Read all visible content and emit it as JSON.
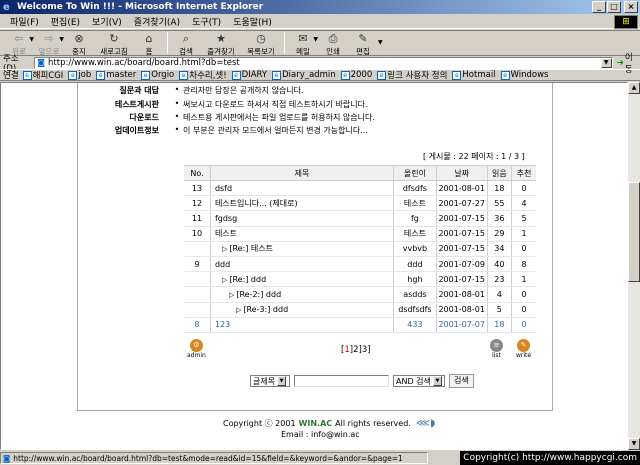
{
  "window": {
    "title": "Welcome To Win !!! - Microsoft Internet Explorer"
  },
  "menu": [
    "파일(F)",
    "편집(E)",
    "보기(V)",
    "즐겨찾기(A)",
    "도구(T)",
    "도움말(H)"
  ],
  "toolbar": {
    "back": "뒤로",
    "forward": "앞으로",
    "stop": "중지",
    "refresh": "새로고침",
    "home": "홈",
    "search": "검색",
    "favorites": "즐겨찾기",
    "history": "목록보기",
    "mail": "메일",
    "print": "인쇄",
    "edit": "편집"
  },
  "address": {
    "label": "주소(D)",
    "url": "http://www.win.ac/board/board.html?db=test",
    "go": "이동"
  },
  "links": {
    "label": "연결",
    "items": [
      "해피CGI",
      "job",
      "master",
      "Orgio",
      "차수리,셋!",
      "DIARY",
      "Diary_admin",
      "2000",
      "링크 사용자 정의",
      "Hotmail",
      "Windows"
    ]
  },
  "info": [
    {
      "key": "질문과 대답",
      "value": "관리자만 답장은 공개하지 않습니다."
    },
    {
      "key": "테스트게시판",
      "value": "써보시고 다운로드 하셔서 직접 테스트하시기 바랍니다."
    },
    {
      "key": "다운로드",
      "value": "테스트용 게시판에서는 파일 업로드를 허용하지 않습니다."
    },
    {
      "key": "업데이트정보",
      "value": "이 부분은 관리자 모드에서 얼마든지 변경 가능합니다..."
    }
  ],
  "board": {
    "status": "[ 게시물 : 22    페이지 : 1 / 3 ]",
    "headers": [
      "No.",
      "제목",
      "올린이",
      "날짜",
      "읽음",
      "추천"
    ],
    "rows": [
      {
        "no": "13",
        "title": "dsfd",
        "author": "dfsdfs",
        "date": "2001-08-01",
        "reads": "18",
        "rec": "0",
        "depth": 0
      },
      {
        "no": "12",
        "title": "테스트입니다... (제대로)",
        "author": "테스트",
        "date": "2001-07-27",
        "reads": "55",
        "rec": "4",
        "depth": 0
      },
      {
        "no": "11",
        "title": "fgdsg",
        "author": "fg",
        "date": "2001-07-15",
        "reads": "36",
        "rec": "5",
        "depth": 0
      },
      {
        "no": "10",
        "title": "테스트",
        "author": "테스트",
        "date": "2001-07-15",
        "reads": "29",
        "rec": "1",
        "depth": 0
      },
      {
        "no": "",
        "title": "[Re:] 테스트",
        "author": "vvbvb",
        "date": "2001-07-15",
        "reads": "34",
        "rec": "0",
        "depth": 1
      },
      {
        "no": "9",
        "title": "ddd",
        "author": "ddd",
        "date": "2001-07-09",
        "reads": "40",
        "rec": "8",
        "depth": 0
      },
      {
        "no": "",
        "title": "[Re:] ddd",
        "author": "hgh",
        "date": "2001-07-15",
        "reads": "23",
        "rec": "1",
        "depth": 1
      },
      {
        "no": "",
        "title": "[Re-2:] ddd",
        "author": "asdds",
        "date": "2001-08-01",
        "reads": "4",
        "rec": "0",
        "depth": 2
      },
      {
        "no": "",
        "title": "[Re-3:] ddd",
        "author": "dsdfsdfs",
        "date": "2001-08-01",
        "reads": "5",
        "rec": "0",
        "depth": 3
      },
      {
        "no": "8",
        "title": "123",
        "author": "433",
        "date": "2001-07-07",
        "reads": "18",
        "rec": "0",
        "depth": 0,
        "highlight": true
      }
    ],
    "reply_marker": "▷",
    "pager": {
      "open": "[",
      "pages": [
        "1",
        "2",
        "3"
      ],
      "close": "]"
    },
    "admin_label": "admin",
    "list_label": "list",
    "write_label": "write"
  },
  "search": {
    "field": "글제목",
    "mode": "AND 검색",
    "button": "검색"
  },
  "footer": {
    "copyright_pre": "Copyright ⓒ 2001",
    "brand": "WIN.AC",
    "copyright_post": "All rights reserved.",
    "email": "Email : info@win.ac"
  },
  "statusbar": {
    "text": "http://www.win.ac/board/board.html?db=test&mode=read&id=15&field=&keyword=&andor=&page=1",
    "watermark": "Copyright(c) http://www.happycgi.com"
  }
}
